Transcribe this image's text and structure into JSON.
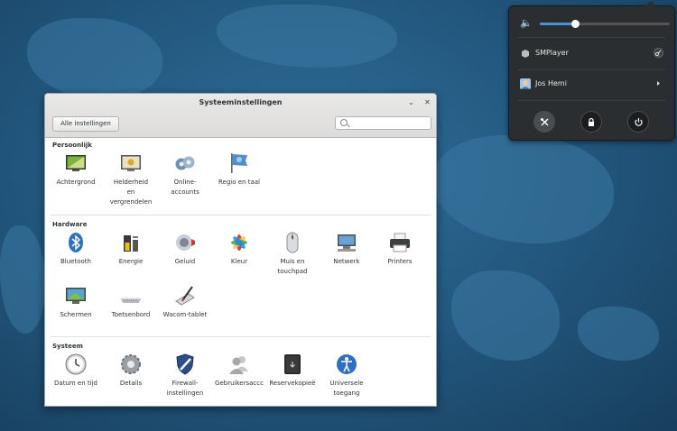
{
  "system_menu": {
    "volume_level": 0.27,
    "media_player": "SMPlayer",
    "user_name": "Jos Hemi"
  },
  "window": {
    "title": "Systeeminstellingen",
    "minimize_glyph": "⌄",
    "close_glyph": "✕",
    "all_settings_label": "Alle instellingen",
    "search_placeholder": ""
  },
  "sections": {
    "personal": {
      "title": "Persoonlijk",
      "items": [
        {
          "label": "Achtergrond",
          "icon": "background-icon"
        },
        {
          "label": "Helderheid\nen\nvergrendelen",
          "icon": "brightness-lock-icon"
        },
        {
          "label": "Online-\naccounts",
          "icon": "online-accounts-icon"
        },
        {
          "label": "Regio en taal",
          "icon": "region-language-icon"
        }
      ]
    },
    "hardware": {
      "title": "Hardware",
      "items": [
        {
          "label": "Bluetooth",
          "icon": "bluetooth-icon"
        },
        {
          "label": "Energie",
          "icon": "power-icon"
        },
        {
          "label": "Geluid",
          "icon": "sound-icon"
        },
        {
          "label": "Kleur",
          "icon": "color-icon"
        },
        {
          "label": "Muis en\ntouchpad",
          "icon": "mouse-icon"
        },
        {
          "label": "Netwerk",
          "icon": "network-icon"
        },
        {
          "label": "Printers",
          "icon": "printer-icon"
        },
        {
          "label": "Schermen",
          "icon": "display-icon"
        },
        {
          "label": "Toetsenbord",
          "icon": "keyboard-icon"
        },
        {
          "label": "Wacom-tablet",
          "icon": "wacom-tablet-icon"
        }
      ]
    },
    "system": {
      "title": "Systeem",
      "items": [
        {
          "label": "Datum en tijd",
          "icon": "clock-icon"
        },
        {
          "label": "Details",
          "icon": "details-gear-icon"
        },
        {
          "label": "Firewall-\ninstellingen",
          "icon": "firewall-shield-icon"
        },
        {
          "label": "Gebruikersaccc",
          "icon": "users-icon"
        },
        {
          "label": "Reservekopieë",
          "icon": "backup-safe-icon"
        },
        {
          "label": "Universele\ntoegang",
          "icon": "accessibility-icon"
        }
      ]
    }
  },
  "colors": {
    "accent": "#4a90d9",
    "desktop": "#245a82",
    "menu_bg": "#2b2e30"
  }
}
